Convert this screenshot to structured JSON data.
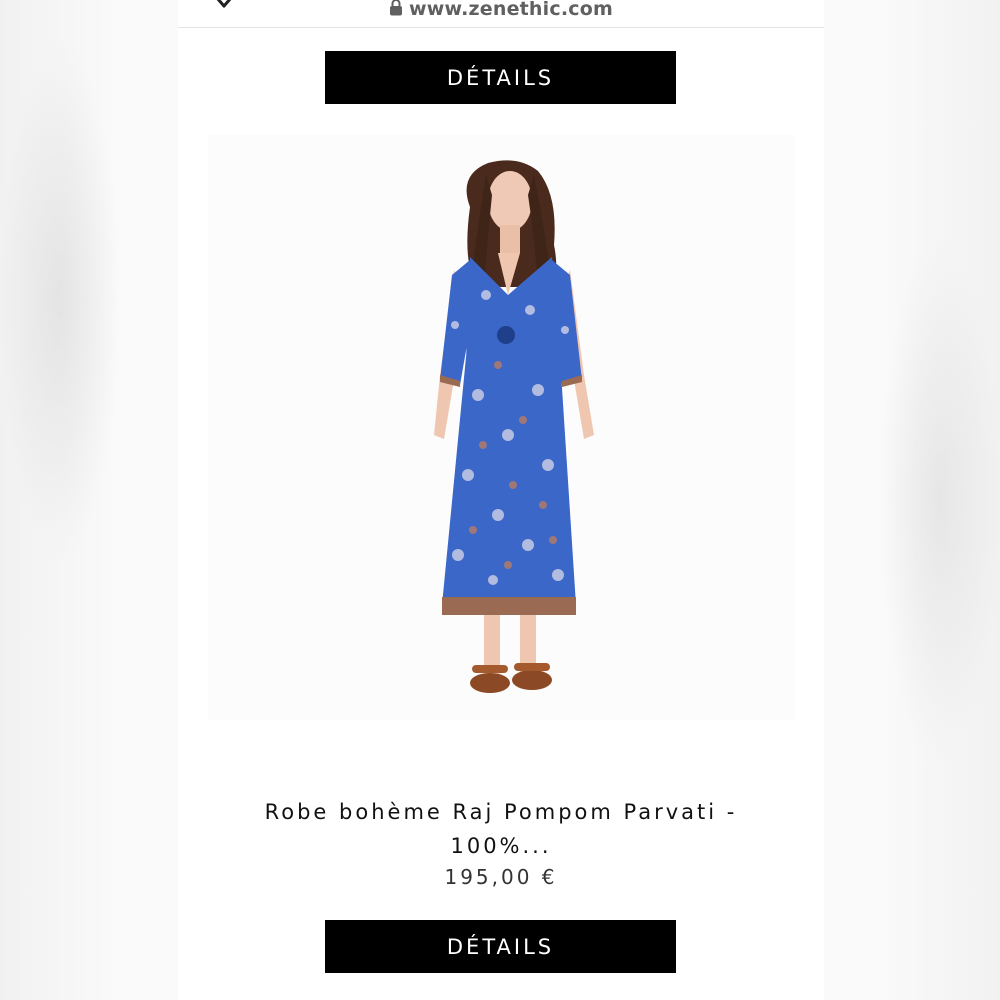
{
  "browser": {
    "url": "www.zenethic.com",
    "close_icon": "close-icon",
    "lock_icon": "lock-icon"
  },
  "product": {
    "details_label_top": "DÉTAILS",
    "title": "Robe bohème Raj Pompom Parvati - 100%...",
    "price": "195,00 €",
    "details_label_bottom": "DÉTAILS"
  },
  "colors": {
    "button_bg": "#000000",
    "button_text": "#ffffff",
    "dress_blue": "#3b67c9",
    "dress_border": "#9b6a52"
  }
}
